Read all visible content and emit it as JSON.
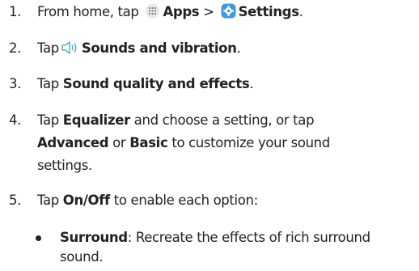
{
  "steps": [
    {
      "n": "1.",
      "t1": "From home, tap",
      "b1": "Apps",
      "sep": ">",
      "b2": "Settings",
      "end": "."
    },
    {
      "n": "2.",
      "t1": "Tap",
      "b1": "Sounds and vibration",
      "end": "."
    },
    {
      "n": "3.",
      "t1": "Tap",
      "b1": "Sound quality and effects",
      "end": "."
    },
    {
      "n": "4.",
      "t1": "Tap",
      "b1": "Equalizer",
      "t2": "and choose a setting, or tap",
      "b2": "Advanced",
      "t3": "or",
      "b3": "Basic",
      "t4": "to customize your sound",
      "t5": "settings."
    },
    {
      "n": "5.",
      "t1": "Tap",
      "b1": "On/Off",
      "t2": "to enable each option:"
    }
  ],
  "bullet": {
    "b1": "Surround",
    "t1": ": Recreate the effects of rich surround",
    "t2": "sound."
  },
  "icons": {
    "apps": "apps-grid-icon",
    "settings": "settings-gear-icon",
    "sound": "speaker-volume-icon"
  },
  "colors": {
    "text": "#222222",
    "settings_icon": "#3E9BE0",
    "apps_icon_bg": "#E9E9E9"
  }
}
